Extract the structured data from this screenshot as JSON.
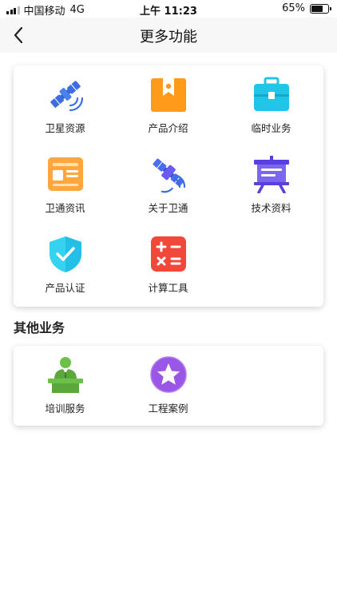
{
  "status_bar": {
    "carrier": "中国移动",
    "network": "4G",
    "time": "上午 11:23",
    "battery": "65%"
  },
  "nav": {
    "title": "更多功能",
    "back_icon": "chevron-left-icon"
  },
  "main_grid": {
    "items": [
      {
        "label": "卫星资源",
        "icon": "satellite-icon"
      },
      {
        "label": "产品介绍",
        "icon": "bookmark-icon"
      },
      {
        "label": "临时业务",
        "icon": "briefcase-icon"
      },
      {
        "label": "卫通资讯",
        "icon": "news-icon"
      },
      {
        "label": "关于卫通",
        "icon": "satellite-icon"
      },
      {
        "label": "技术资料",
        "icon": "presentation-board-icon"
      },
      {
        "label": "产品认证",
        "icon": "shield-check-icon"
      },
      {
        "label": "计算工具",
        "icon": "calculator-icon"
      }
    ]
  },
  "other_section": {
    "title": "其他业务",
    "items": [
      {
        "label": "培训服务",
        "icon": "trainer-icon"
      },
      {
        "label": "工程案例",
        "icon": "star-icon"
      }
    ]
  },
  "colors": {
    "satellite_blue": "#3b6fe0",
    "orange": "#ff9a1a",
    "cyan": "#20c5e8",
    "news_orange": "#ffa63c",
    "board_purple": "#5a3fe0",
    "shield_cyan": "#36d3f0",
    "calc_red": "#f2483a",
    "trainer_green": "#6cc04a",
    "star_purple": "#9a57e6"
  }
}
